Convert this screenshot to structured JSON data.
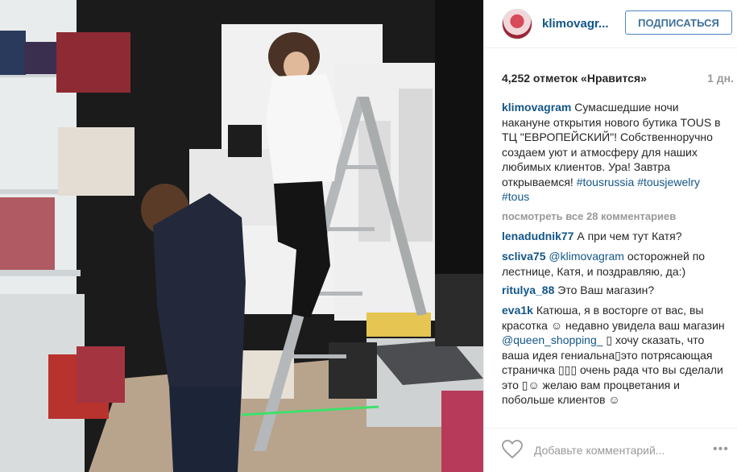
{
  "header": {
    "username": "klimovagr...",
    "follow_label": "ПОДПИСАТЬСЯ"
  },
  "stats": {
    "likes": "4,252 отметок «Нравится»",
    "age": "1 дн."
  },
  "caption": {
    "username": "klimovagram",
    "text": " Сумасшедшие ночи накануне открытия нового бутика TOUS в ТЦ \"ЕВРОПЕЙСКИЙ\"! Собственноручно создаем уют и атмосферу для наших любимых клиентов. Ура! Завтра открываемся! ",
    "hashtags": [
      "#tousrussia",
      "#tousjewelry",
      "#tous"
    ]
  },
  "view_all": "посмотреть все 28 комментариев",
  "comments": [
    {
      "username": "lenadudnik77",
      "text": " А при чем тут Катя?"
    },
    {
      "username": "scliva75",
      "mention": "@klimovagram",
      "text": " осторожней по лестнице, Катя, и поздравляю, да:)"
    },
    {
      "username": "ritulya_88",
      "text": " Это Ваш магазин?"
    },
    {
      "username": "eva1k",
      "text_1": " Катюша, я в восторге от вас, вы красотка ☺ недавно увидела ваш магазин ",
      "mention": "@queen_shopping_",
      "text_2": " ▯ хочу сказать, что ваша идея гениальна▯это потрясающая страничка ▯▯▯ очень рада что вы сделали это ▯☺ желаю вам процветания и побольше клиентов ☺"
    }
  ],
  "footer": {
    "placeholder": "Добавьте комментарий...",
    "more": "•••"
  },
  "photo": {
    "description": "Boutique interior",
    "colors": {
      "wall": "#1b1b1b",
      "panel": "#f2f2f2",
      "shelf": "#cfd4d6",
      "floor": "#b8a48d",
      "ladder": "#b5b8ba",
      "tape": "#3ee06a"
    }
  },
  "colors": {
    "link": "#125688",
    "muted": "#999999",
    "follow_border": "#4d85c1",
    "follow_text": "#3f729b"
  }
}
